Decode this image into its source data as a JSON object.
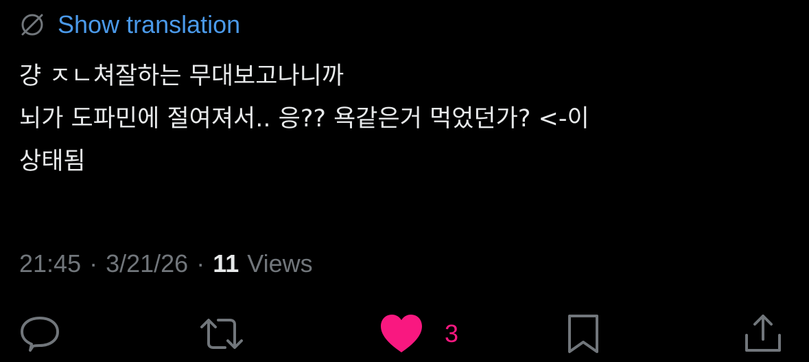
{
  "translation": {
    "icon": "globe-slash-icon",
    "label": "Show translation"
  },
  "tweet": {
    "text": "걍 ㅈㄴ쳐잘하는 무대보고나니까\n뇌가 도파민에 절여져서.. 응?? 욕같은거 먹었던가? <-이\n상태됨"
  },
  "meta": {
    "time": "21:45",
    "separator": "·",
    "date": "3/21/26",
    "views_count": "11",
    "views_label": "Views"
  },
  "actions": {
    "reply": {
      "icon": "reply-icon"
    },
    "retweet": {
      "icon": "retweet-icon"
    },
    "like": {
      "icon": "heart-filled-icon",
      "count": "3"
    },
    "bookmark": {
      "icon": "bookmark-icon"
    },
    "share": {
      "icon": "share-icon"
    }
  },
  "colors": {
    "background": "#000000",
    "text": "#e7e9ea",
    "muted": "#71767b",
    "link": "#4a99e9",
    "like": "#f91880"
  }
}
